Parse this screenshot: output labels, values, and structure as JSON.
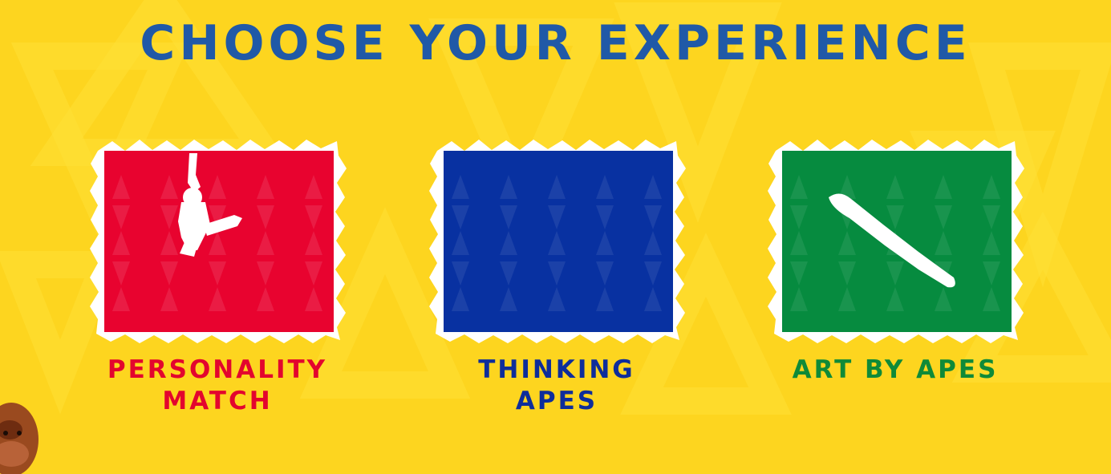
{
  "page": {
    "title": "CHOOSE YOUR EXPERIENCE",
    "colors": {
      "background": "#fdd51f",
      "title": "#2059a7",
      "frame": "#ffffff"
    }
  },
  "cards": [
    {
      "line1": "PERSONALITY",
      "line2": "MATCH",
      "color": "#e8032f",
      "text_color": "#e3052e",
      "icon": "ape-silhouette-icon"
    },
    {
      "line1": "THINKING",
      "line2": "APES",
      "color": "#0831a1",
      "text_color": "#0e2d9b",
      "icon": "none"
    },
    {
      "line1": "ART BY APES",
      "line2": "",
      "color": "#068b3f",
      "text_color": "#0f8a38",
      "icon": "paint-stroke-icon"
    }
  ]
}
